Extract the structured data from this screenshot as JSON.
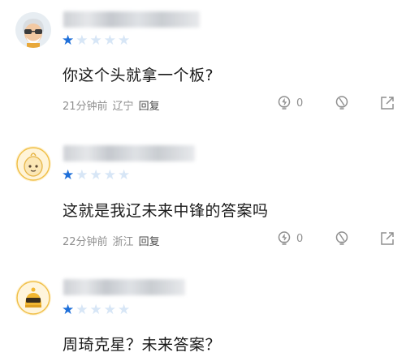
{
  "comments": [
    {
      "avatar": "old-man-glasses-avatar",
      "rating": 1,
      "max_rating": 5,
      "text": "你这个头就拿一个板?",
      "time": "21分钟前",
      "location": "辽宁",
      "reply_label": "回复",
      "like_count": "0"
    },
    {
      "avatar": "cartoon-egg-avatar",
      "rating": 1,
      "max_rating": 5,
      "text": "这就是我辽未来中锋的答案吗",
      "time": "22分钟前",
      "location": "浙江",
      "reply_label": "回复",
      "like_count": "0"
    },
    {
      "avatar": "yellow-sunglasses-avatar",
      "rating": 1,
      "max_rating": 5,
      "text": "周琦克星？未来答案？"
    }
  ],
  "icons": {
    "like": "lightbulb-icon",
    "dislike": "lightbulb-off-icon",
    "share": "share-icon"
  },
  "colors": {
    "star_on": "#1e6fd9",
    "star_off": "#d7e6f6",
    "meta_text": "#8f8f8f"
  }
}
